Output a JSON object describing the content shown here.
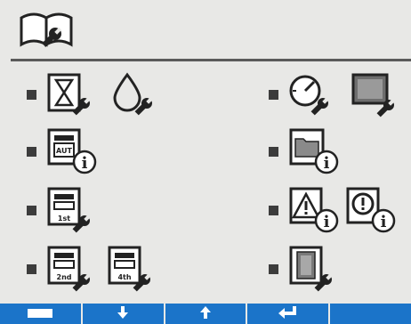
{
  "screen": {
    "header_icon": "manual-wrench-icon",
    "accent_color": "#1b74c9"
  },
  "menu": {
    "left": [
      {
        "icons": [
          "hourglass-wrench-icon",
          "water-drop-wrench-icon"
        ]
      },
      {
        "icons": [
          "auto-machine-info-icon"
        ]
      },
      {
        "icons": [
          "machine-1st-wrench-icon"
        ]
      },
      {
        "icons": [
          "machine-2nd-wrench-icon",
          "machine-4th-wrench-icon"
        ]
      }
    ],
    "right": [
      {
        "icons": [
          "gauge-wrench-icon",
          "display-wrench-icon"
        ]
      },
      {
        "icons": [
          "folder-info-icon"
        ]
      },
      {
        "icons": [
          "warning-info-icon",
          "alarm-info-icon"
        ]
      },
      {
        "icons": [
          "door-wrench-icon"
        ]
      }
    ]
  },
  "machine_labels": {
    "auto": "AUT",
    "first": "1st",
    "second": "2nd",
    "fourth": "4th"
  },
  "toolbar": {
    "buttons": [
      "keyboard-icon",
      "arrow-down-icon",
      "arrow-up-icon",
      "enter-icon",
      "blank"
    ]
  }
}
